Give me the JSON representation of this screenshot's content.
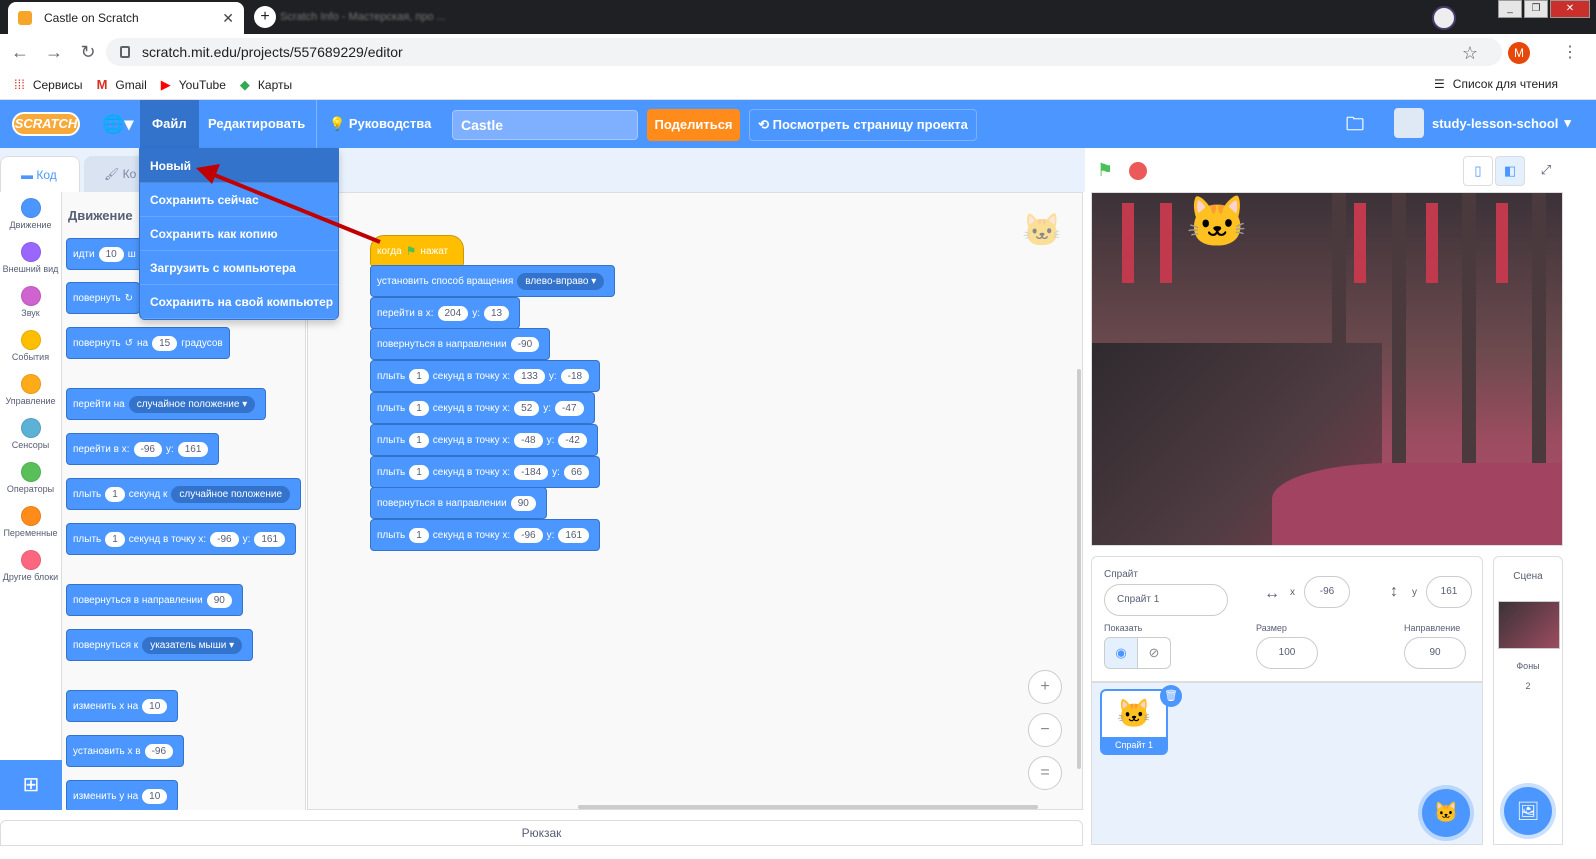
{
  "browser": {
    "tab_title": "Castle on Scratch",
    "tab_close": "✕",
    "second_tab_title": "Scratch Info - Мастерская, про ...",
    "new_tab": "+",
    "url": "scratch.mit.edu/projects/557689229/editor",
    "profile_initial": "M",
    "bookmarks": [
      {
        "label": "Сервисы",
        "icon": "apps-icon"
      },
      {
        "label": "Gmail",
        "icon": "gmail-icon"
      },
      {
        "label": "YouTube",
        "icon": "youtube-icon"
      },
      {
        "label": "Карты",
        "icon": "maps-icon"
      }
    ],
    "reading_list": "Список для чтения"
  },
  "menubar": {
    "logo": "SCRATCH",
    "file": "Файл",
    "edit": "Редактировать",
    "guides": "Руководства",
    "project_title": "Castle",
    "share": "Поделиться",
    "see_project": "Посмотреть страницу проекта",
    "username": "study-lesson-school",
    "colors": {
      "primary": "#4c97ff",
      "share": "#ff8c1a"
    }
  },
  "file_menu": {
    "items": [
      "Новый",
      "Сохранить сейчас",
      "Сохранить как копию",
      "Загрузить с компьютера",
      "Сохранить на свой компьютер"
    ],
    "selected_index": 0
  },
  "editor_tabs": {
    "code": "Код",
    "costumes": "Ко"
  },
  "categories": [
    {
      "label": "Движение",
      "color": "#4c97ff"
    },
    {
      "label": "Внешний вид",
      "color": "#9966ff"
    },
    {
      "label": "Звук",
      "color": "#cf63cf"
    },
    {
      "label": "События",
      "color": "#ffbf00"
    },
    {
      "label": "Управление",
      "color": "#ffab19"
    },
    {
      "label": "Сенсоры",
      "color": "#5cb1d6"
    },
    {
      "label": "Операторы",
      "color": "#59c059"
    },
    {
      "label": "Переменные",
      "color": "#ff8c1a"
    },
    {
      "label": "Другие блоки",
      "color": "#ff6680"
    }
  ],
  "palette": {
    "title": "Движение",
    "blocks": {
      "move": {
        "a": "идти",
        "n": "10",
        "b": "ш"
      },
      "turn_right": {
        "a": "повернуть",
        "icon": "↻"
      },
      "turn_left": {
        "a": "повернуть",
        "icon": "↺",
        "b": "на",
        "n": "15",
        "c": "градусов"
      },
      "goto": {
        "a": "перейти на",
        "dd": "случайное положение ▾"
      },
      "goto_xy": {
        "a": "перейти в x:",
        "x": "-96",
        "y_lbl": "y:",
        "y": "161"
      },
      "glide": {
        "a": "плыть",
        "n": "1",
        "b": "секунд к",
        "dd": "случайное положение"
      },
      "glide_xy": {
        "a": "плыть",
        "n": "1",
        "b": "секунд в точку x:",
        "x": "-96",
        "y_lbl": "y:",
        "y": "161"
      },
      "point_dir": {
        "a": "повернуться в направлении",
        "n": "90"
      },
      "point_towards": {
        "a": "повернуться к",
        "dd": "указатель мыши ▾"
      },
      "change_x": {
        "a": "изменить х на",
        "n": "10"
      },
      "set_x": {
        "a": "установить х в",
        "n": "-96"
      },
      "change_y": {
        "a": "изменить у на",
        "n": "10"
      }
    }
  },
  "script": {
    "hat": {
      "a": "когда",
      "flag": "⚑",
      "b": "нажат"
    },
    "rotation": {
      "a": "установить способ вращения",
      "dd": "влево-вправо ▾"
    },
    "goto": {
      "a": "перейти в x:",
      "x": "204",
      "y_lbl": "y:",
      "y": "13"
    },
    "point1": {
      "a": "повернуться в направлении",
      "n": "-90"
    },
    "glides": [
      {
        "a": "плыть",
        "n": "1",
        "b": "секунд в точку x:",
        "x": "133",
        "y_lbl": "y:",
        "y": "-18"
      },
      {
        "a": "плыть",
        "n": "1",
        "b": "секунд в точку x:",
        "x": "52",
        "y_lbl": "y:",
        "y": "-47"
      },
      {
        "a": "плыть",
        "n": "1",
        "b": "секунд в точку x:",
        "x": "-48",
        "y_lbl": "y:",
        "y": "-42"
      },
      {
        "a": "плыть",
        "n": "1",
        "b": "секунд в точку x:",
        "x": "-184",
        "y_lbl": "y:",
        "y": "66"
      }
    ],
    "point2": {
      "a": "повернуться в направлении",
      "n": "90"
    },
    "glide_last": {
      "a": "плыть",
      "n": "1",
      "b": "секунд в точку x:",
      "x": "-96",
      "y_lbl": "y:",
      "y": "161"
    },
    "zoom_in": "+",
    "zoom_out": "−",
    "zoom_reset": "="
  },
  "sprite_info": {
    "sprite_label": "Спрайт",
    "sprite_name": "Спрайт 1",
    "x_label": "x",
    "x": "-96",
    "y_label": "y",
    "y": "161",
    "show_label": "Показать",
    "size_label": "Размер",
    "size": "100",
    "direction_label": "Направление",
    "direction": "90"
  },
  "sprites": [
    {
      "name": "Спрайт 1"
    }
  ],
  "stage_pane": {
    "title": "Сцена",
    "backdrops_label": "Фоны",
    "backdrops_count": "2"
  },
  "backpack": "Рюкзак"
}
